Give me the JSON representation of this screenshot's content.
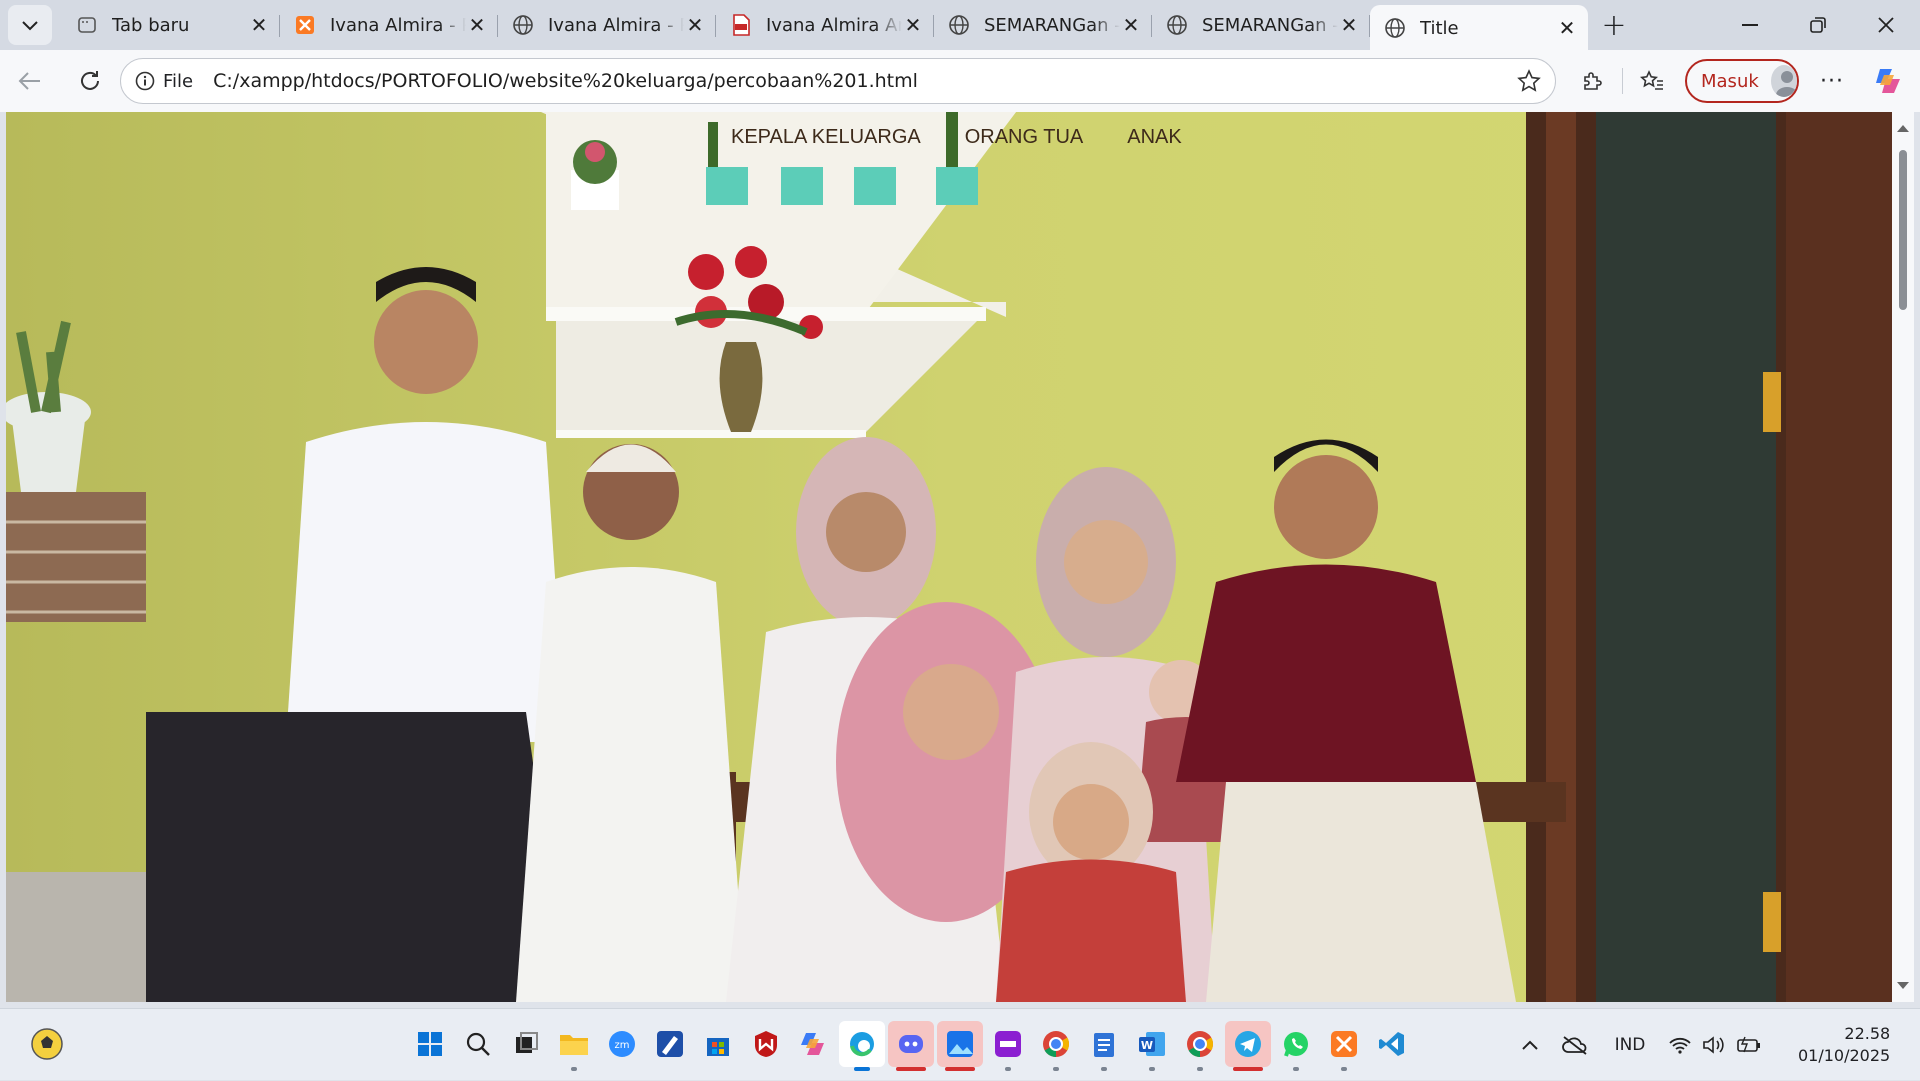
{
  "browser": {
    "tabs": [
      {
        "title": "Tab baru",
        "icon": "new-tab-page-icon"
      },
      {
        "title": "Ivana Almira - P",
        "icon": "xampp-icon"
      },
      {
        "title": "Ivana Almira - P",
        "icon": "globe-icon"
      },
      {
        "title": "Ivana Almira An",
        "icon": "pdf-icon"
      },
      {
        "title": "SEMARANGan -",
        "icon": "globe-icon"
      },
      {
        "title": "SEMARANGan -",
        "icon": "globe-icon"
      },
      {
        "title": "Title",
        "icon": "globe-icon",
        "active": true
      }
    ],
    "address": {
      "scheme_label": "File",
      "url": "C:/xampp/htdocs/PORTOFOLIO/website%20keluarga/percobaan%201.html"
    },
    "profile_label": "Masuk"
  },
  "page": {
    "nav": [
      "KEPALA KELUARGA",
      "ORANG TUA",
      "ANAK"
    ],
    "hero_image": "family-photo"
  },
  "taskbar": {
    "apps": [
      "start-icon",
      "search-icon",
      "task-view-icon",
      "file-explorer-icon",
      "zoom-icon",
      "editor-icon",
      "store-icon",
      "mcafee-icon",
      "copilot-icon",
      "edge-icon",
      "discord-icon",
      "photos-icon",
      "capcut-icon",
      "chrome-icon",
      "notepad-icon",
      "word-icon",
      "chrome-icon",
      "telegram-icon",
      "whatsapp-icon",
      "xampp-icon",
      "vscode-icon"
    ],
    "language": "IND",
    "time": "22.58",
    "date": "01/10/2025"
  },
  "colors": {
    "accent_red": "#b3261e",
    "nav_text": "#3d2a1a"
  }
}
